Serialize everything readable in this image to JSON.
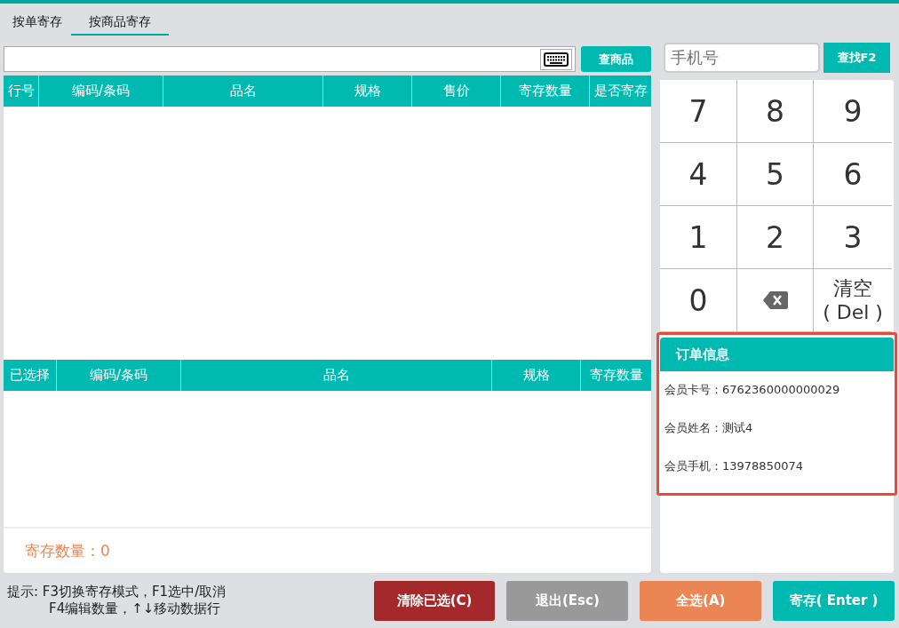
{
  "tabs": [
    {
      "label": "按单寄存",
      "selected": false
    },
    {
      "label": "按商品寄存",
      "selected": true
    }
  ],
  "product_search": {
    "button": "查商品"
  },
  "product_table": {
    "columns": [
      "行号",
      "编码/条码",
      "品名",
      "规格",
      "售价",
      "寄存数量",
      "是否寄存"
    ]
  },
  "selected_table": {
    "columns": [
      "已选择",
      "编码/条码",
      "品名",
      "规格",
      "寄存数量"
    ]
  },
  "deposit_count": "寄存数量：0",
  "phone_search": {
    "placeholder": "手机号",
    "button": "查找F2"
  },
  "keypad": [
    {
      "kind": "digit",
      "label": "7"
    },
    {
      "kind": "digit",
      "label": "8"
    },
    {
      "kind": "digit",
      "label": "9"
    },
    {
      "kind": "digit",
      "label": "4"
    },
    {
      "kind": "digit",
      "label": "5"
    },
    {
      "kind": "digit",
      "label": "6"
    },
    {
      "kind": "digit",
      "label": "1"
    },
    {
      "kind": "digit",
      "label": "2"
    },
    {
      "kind": "digit",
      "label": "3"
    },
    {
      "kind": "digit",
      "label": "0"
    },
    {
      "kind": "backspace"
    },
    {
      "kind": "clear",
      "lines": [
        "清空",
        "( Del )"
      ]
    }
  ],
  "order_info": {
    "title": "订单信息",
    "fields": [
      {
        "label": "会员卡号：",
        "value": "6762360000000029"
      },
      {
        "label": "会员姓名：",
        "value": "测试4"
      },
      {
        "label": "会员手机：",
        "value": "13978850074"
      }
    ]
  },
  "hint": [
    "提示: F3切换寄存模式，F1选中/取消",
    "F4编辑数量，↑↓移动数据行"
  ],
  "buttons": [
    {
      "label": "清除已选(C)",
      "color": "#a4292a"
    },
    {
      "label": "退出(Esc)",
      "color": "#999999"
    },
    {
      "label": "全选(A)",
      "color": "#eb8553"
    },
    {
      "label": "寄存( Enter )",
      "color": "#00bab1"
    }
  ]
}
